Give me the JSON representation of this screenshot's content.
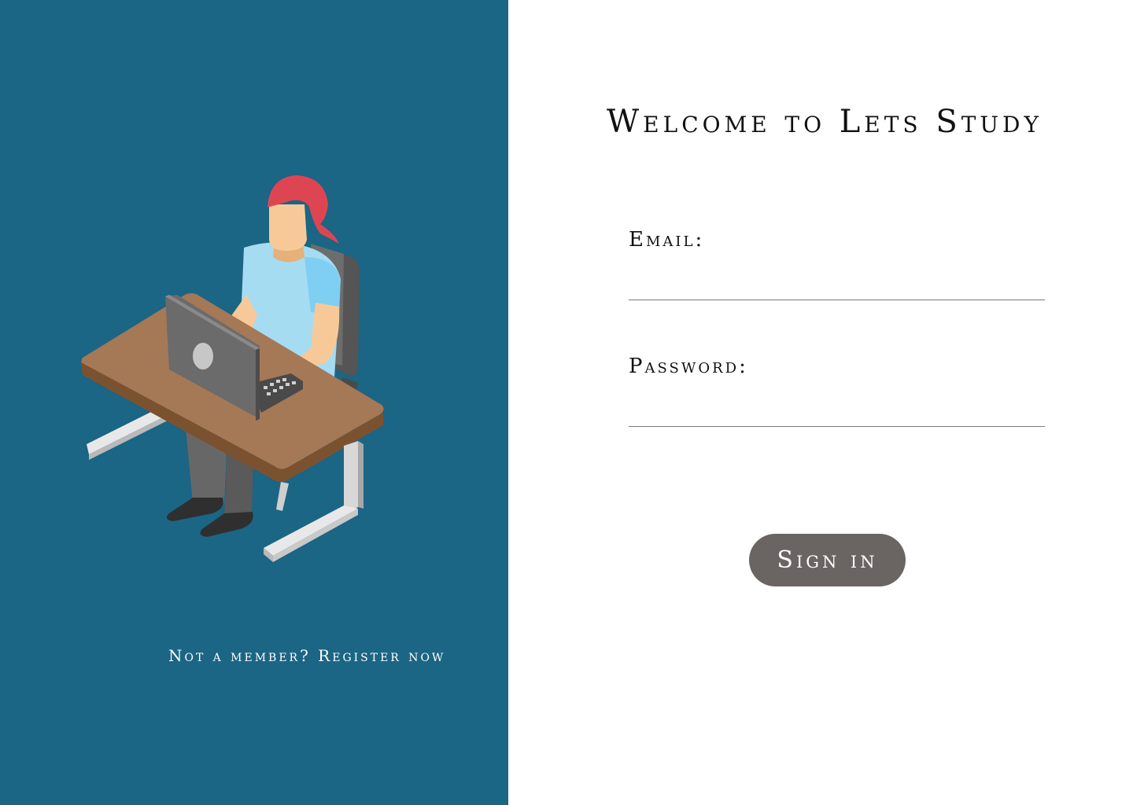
{
  "welcome": {
    "title": "Welcome to Lets Study"
  },
  "form": {
    "email_label": "Email:",
    "email_value": "",
    "password_label": "Password:",
    "password_value": "",
    "signin_label": "Sign in"
  },
  "register": {
    "link_text": "Not a member? Register now"
  },
  "illustration": {
    "icon": "person-at-desk-with-laptop-illustration"
  },
  "colors": {
    "left_panel": "#1b6585",
    "button": "#6a6462",
    "title_text": "#111111"
  }
}
